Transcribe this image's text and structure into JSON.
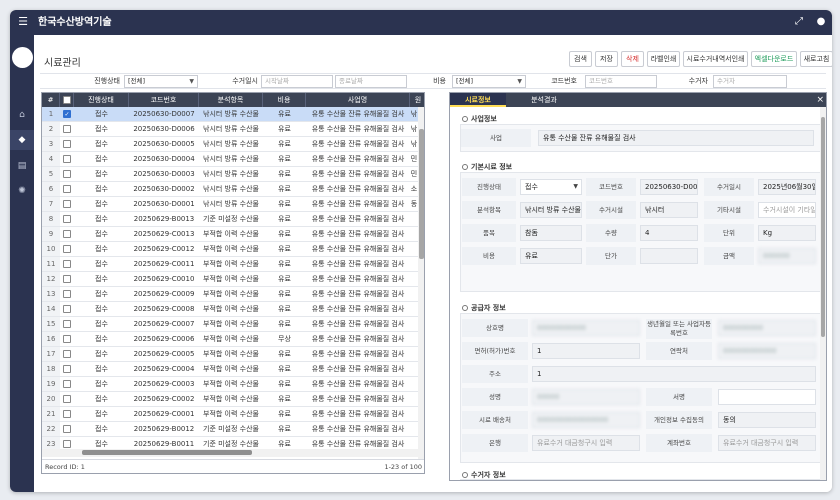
{
  "app": {
    "title": "한국수산방역기술"
  },
  "page": {
    "title": "시료관리"
  },
  "toolbar": {
    "search": "검색",
    "save": "저장",
    "delete": "삭제",
    "label_print": "라벨인쇄",
    "sample_receipt_print": "시료수거내역서인쇄",
    "excel_download": "엑셀다운로드",
    "refresh": "새로고침"
  },
  "filters": {
    "status_label": "진행상태",
    "status_value": "[전체]",
    "date_label": "수거일시",
    "start_placeholder": "시작날짜",
    "end_placeholder": "종료날짜",
    "cost_label": "비용",
    "cost_value": "[전체]",
    "code_label": "코드번호",
    "code_placeholder": "코드번호",
    "collector_label": "수거자",
    "collector_placeholder": "수거자"
  },
  "grid": {
    "columns": [
      "진행상태",
      "코드번호",
      "분석항목",
      "비용",
      "사업명",
      "원"
    ],
    "rows": [
      {
        "n": "1",
        "status": "접수",
        "code": "20250630-D0007",
        "item": "낚시터 방류 수산물",
        "cost": "유료",
        "project": "유통 수산물 잔류 유해물질 검사",
        "extra": "낚",
        "checked": true,
        "selected": true
      },
      {
        "n": "2",
        "status": "접수",
        "code": "20250630-D0006",
        "item": "낚시터 방류 수산물",
        "cost": "유료",
        "project": "유통 수산물 잔류 유해물질 검사",
        "extra": "낚"
      },
      {
        "n": "3",
        "status": "접수",
        "code": "20250630-D0005",
        "item": "낚시터 방류 수산물",
        "cost": "유료",
        "project": "유통 수산물 잔류 유해물질 검사",
        "extra": "낚"
      },
      {
        "n": "4",
        "status": "접수",
        "code": "20250630-D0004",
        "item": "낚시터 방류 수산물",
        "cost": "유료",
        "project": "유통 수산물 잔류 유해물질 검사",
        "extra": "민"
      },
      {
        "n": "5",
        "status": "접수",
        "code": "20250630-D0003",
        "item": "낚시터 방류 수산물",
        "cost": "유료",
        "project": "유통 수산물 잔류 유해물질 검사",
        "extra": "민"
      },
      {
        "n": "6",
        "status": "접수",
        "code": "20250630-D0002",
        "item": "낚시터 방류 수산물",
        "cost": "유료",
        "project": "유통 수산물 잔류 유해물질 검사",
        "extra": "소"
      },
      {
        "n": "7",
        "status": "접수",
        "code": "20250630-D0001",
        "item": "낚시터 방류 수산물",
        "cost": "유료",
        "project": "유통 수산물 잔류 유해물질 검사",
        "extra": "동"
      },
      {
        "n": "8",
        "status": "접수",
        "code": "20250629-B0013",
        "item": "기준 미설정 수산물",
        "cost": "유료",
        "project": "유통 수산물 잔류 유해물질 검사",
        "extra": ""
      },
      {
        "n": "9",
        "status": "접수",
        "code": "20250629-C0013",
        "item": "부적합 이력 수산물",
        "cost": "유료",
        "project": "유통 수산물 잔류 유해물질 검사",
        "extra": ""
      },
      {
        "n": "10",
        "status": "접수",
        "code": "20250629-C0012",
        "item": "부적합 이력 수산물",
        "cost": "유료",
        "project": "유통 수산물 잔류 유해물질 검사",
        "extra": ""
      },
      {
        "n": "11",
        "status": "접수",
        "code": "20250629-C0011",
        "item": "부적합 이력 수산물",
        "cost": "유료",
        "project": "유통 수산물 잔류 유해물질 검사",
        "extra": ""
      },
      {
        "n": "12",
        "status": "접수",
        "code": "20250629-C0010",
        "item": "부적합 이력 수산물",
        "cost": "유료",
        "project": "유통 수산물 잔류 유해물질 검사",
        "extra": ""
      },
      {
        "n": "13",
        "status": "접수",
        "code": "20250629-C0009",
        "item": "부적합 이력 수산물",
        "cost": "유료",
        "project": "유통 수산물 잔류 유해물질 검사",
        "extra": ""
      },
      {
        "n": "14",
        "status": "접수",
        "code": "20250629-C0008",
        "item": "부적합 이력 수산물",
        "cost": "유료",
        "project": "유통 수산물 잔류 유해물질 검사",
        "extra": ""
      },
      {
        "n": "15",
        "status": "접수",
        "code": "20250629-C0007",
        "item": "부적합 이력 수산물",
        "cost": "유료",
        "project": "유통 수산물 잔류 유해물질 검사",
        "extra": ""
      },
      {
        "n": "16",
        "status": "접수",
        "code": "20250629-C0006",
        "item": "부적합 이력 수산물",
        "cost": "무상",
        "project": "유통 수산물 잔류 유해물질 검사",
        "extra": ""
      },
      {
        "n": "17",
        "status": "접수",
        "code": "20250629-C0005",
        "item": "부적합 이력 수산물",
        "cost": "유료",
        "project": "유통 수산물 잔류 유해물질 검사",
        "extra": ""
      },
      {
        "n": "18",
        "status": "접수",
        "code": "20250629-C0004",
        "item": "부적합 이력 수산물",
        "cost": "유료",
        "project": "유통 수산물 잔류 유해물질 검사",
        "extra": ""
      },
      {
        "n": "19",
        "status": "접수",
        "code": "20250629-C0003",
        "item": "부적합 이력 수산물",
        "cost": "유료",
        "project": "유통 수산물 잔류 유해물질 검사",
        "extra": ""
      },
      {
        "n": "20",
        "status": "접수",
        "code": "20250629-C0002",
        "item": "부적합 이력 수산물",
        "cost": "유료",
        "project": "유통 수산물 잔류 유해물질 검사",
        "extra": ""
      },
      {
        "n": "21",
        "status": "접수",
        "code": "20250629-C0001",
        "item": "부적합 이력 수산물",
        "cost": "유료",
        "project": "유통 수산물 잔류 유해물질 검사",
        "extra": ""
      },
      {
        "n": "22",
        "status": "접수",
        "code": "20250629-B0012",
        "item": "기준 미설정 수산물",
        "cost": "유료",
        "project": "유통 수산물 잔류 유해물질 검사",
        "extra": ""
      },
      {
        "n": "23",
        "status": "접수",
        "code": "20250629-B0011",
        "item": "기준 미설정 수산물",
        "cost": "유료",
        "project": "유통 수산물 잔류 유해물질 검사",
        "extra": ""
      }
    ],
    "footer_left": "Record ID: 1",
    "footer_right": "1-23 of 100"
  },
  "detail": {
    "tabs": [
      "시료정보",
      "분석결과"
    ],
    "close": "×",
    "sections": {
      "project": "사업정보",
      "basic": "기본시료 정보",
      "supplier": "공급자 정보",
      "collector": "수거자 정보"
    },
    "project": {
      "label": "사업",
      "value": "유통 수산물 잔류 유해물질 검사"
    },
    "basic": {
      "status_label": "진행상태",
      "status_value": "접수",
      "code_label": "코드번호",
      "code_value": "20250630-D000",
      "date_label": "수거일시",
      "date_value": "2025년06월30일",
      "item_label": "분석항목",
      "item_value": "낚시터 방류 수산물",
      "place_label": "수거시설",
      "place_value": "낚시터",
      "other_label": "기타시설",
      "other_placeholder": "수거시설이 기타일경",
      "kind_label": "품목",
      "kind_value": "참돔",
      "qty_label": "수량",
      "qty_value": "4",
      "unit_label": "단위",
      "unit_value": "Kg",
      "cost_label": "비용",
      "cost_value": "유료",
      "price_label": "단가",
      "price_value": "",
      "amount_label": "금액",
      "amount_value": "000000"
    },
    "supplier": {
      "company_label": "상호명",
      "company_value": "00000000000",
      "birth_label": "생년월일 또는 사업자등록번호",
      "birth_value": "000000000",
      "license_label": "면허(허가)번호",
      "license_value": "1",
      "contact_label": "연락처",
      "contact_value": "000000000000",
      "address_label": "주소",
      "address_value": "1",
      "name_label": "성명",
      "name_value": "00000",
      "sign_label": "서명",
      "sign_value": "",
      "delivery_label": "시료 배송처",
      "delivery_value": "0000000000000000",
      "consent_label": "개인정보 수집동의",
      "consent_value": "동의",
      "bank_label": "은행",
      "bank_placeholder": "유료수거 대금청구시 입력",
      "account_label": "계좌번호",
      "account_placeholder": "유료수거 대금청구시 입력"
    },
    "collector": {
      "org_label": "소속",
      "org_value": "국립한국해양대학교",
      "contact_label": "연락처",
      "contact_value": ""
    }
  },
  "colors": {
    "navbar": "#2b3350",
    "grid_header": "#3c4455",
    "selected_row": "#c9dcf7",
    "delete": "#d63333",
    "excel": "#1d9b5a",
    "active_tab": "#ffdd55"
  },
  "icons": [
    "menu-icon",
    "fullscreen-icon",
    "user-icon",
    "home-icon",
    "tag-icon",
    "document-icon",
    "gear-icon",
    "close-icon"
  ]
}
